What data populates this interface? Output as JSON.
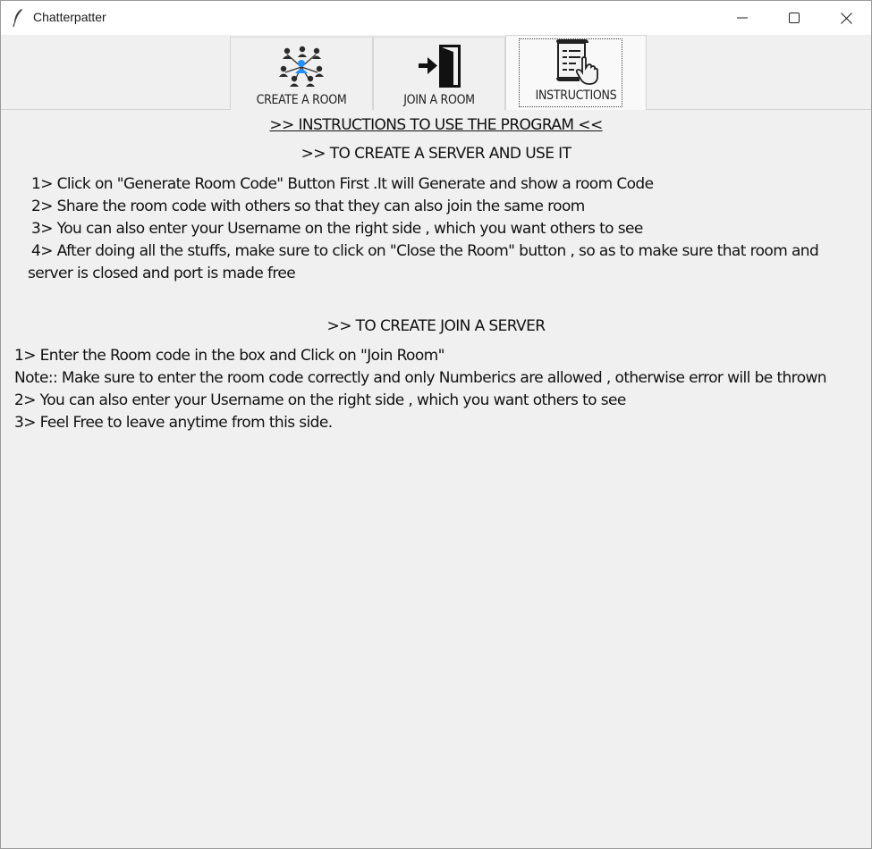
{
  "window": {
    "title": "Chatterpatter",
    "controls": [
      "minimize-icon",
      "maximize-icon",
      "close-icon"
    ]
  },
  "tabs": [
    {
      "id": "create",
      "label": "CREATE A ROOM",
      "icon": "people-network-icon",
      "selected": false
    },
    {
      "id": "join",
      "label": "JOIN A ROOM",
      "icon": "door-enter-icon",
      "selected": false
    },
    {
      "id": "instructions",
      "label": "INSTRUCTIONS",
      "icon": "document-hand-icon",
      "selected": true
    }
  ],
  "instructions": {
    "heading": ">> INSTRUCTIONS TO USE THE PROGRAM <<",
    "server_section": {
      "title": ">> TO CREATE A SERVER AND USE IT",
      "lines": [
        "1> Click on \"Generate Room Code\" Button First .It will Generate and show a room Code",
        "2> Share the room code with others so that they can also join the same room",
        "3> You can also enter your Username on the right side , which you want others to see",
        "4> After doing all the stuffs, make sure to click on \"Close the Room\" button , so as to make sure that room and",
        "server is closed and port is made free"
      ]
    },
    "join_section": {
      "title": ">> TO CREATE JOIN A SERVER",
      "lines": [
        "1> Enter the Room code in the box and Click on \"Join Room\"",
        "Note:: Make sure to enter the room code correctly and only Numberics are allowed , otherwise error will be thrown",
        "2> You can also enter your Username on the right side , which you want others to see",
        "3> Feel Free to leave anytime from this side."
      ]
    }
  },
  "colors": {
    "accent_person": "#1e90ff",
    "text": "#111111",
    "background": "#f0f0f0"
  }
}
